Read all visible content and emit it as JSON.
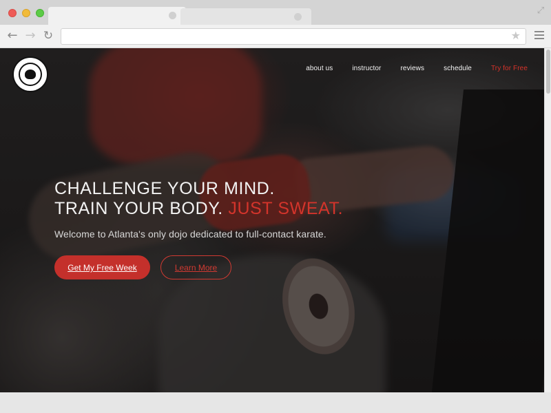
{
  "browser": {
    "window_controls": [
      "close",
      "minimize",
      "maximize"
    ],
    "address": "",
    "icons": [
      "back-arrow-icon",
      "forward-arrow-icon",
      "reload-icon",
      "star-icon",
      "menu-icon",
      "fullscreen-icon"
    ]
  },
  "site": {
    "logo_icon": "karate-organization-seal-icon",
    "nav": {
      "items": [
        {
          "label": "about us"
        },
        {
          "label": "instructor"
        },
        {
          "label": "reviews"
        },
        {
          "label": "schedule"
        }
      ],
      "cta": "Try for Free"
    },
    "hero": {
      "line1": "CHALLENGE YOUR MIND.",
      "line2": "TRAIN YOUR BODY.",
      "line2_accent": "JUST SWEAT.",
      "subtitle": "Welcome to Atlanta's only dojo dedicated to full-contact karate.",
      "primary_button": "Get My Free Week",
      "secondary_button": "Learn More"
    }
  },
  "colors": {
    "accent": "#d3342b",
    "button_primary": "#c4302b",
    "text_light": "#f2f2f2"
  }
}
